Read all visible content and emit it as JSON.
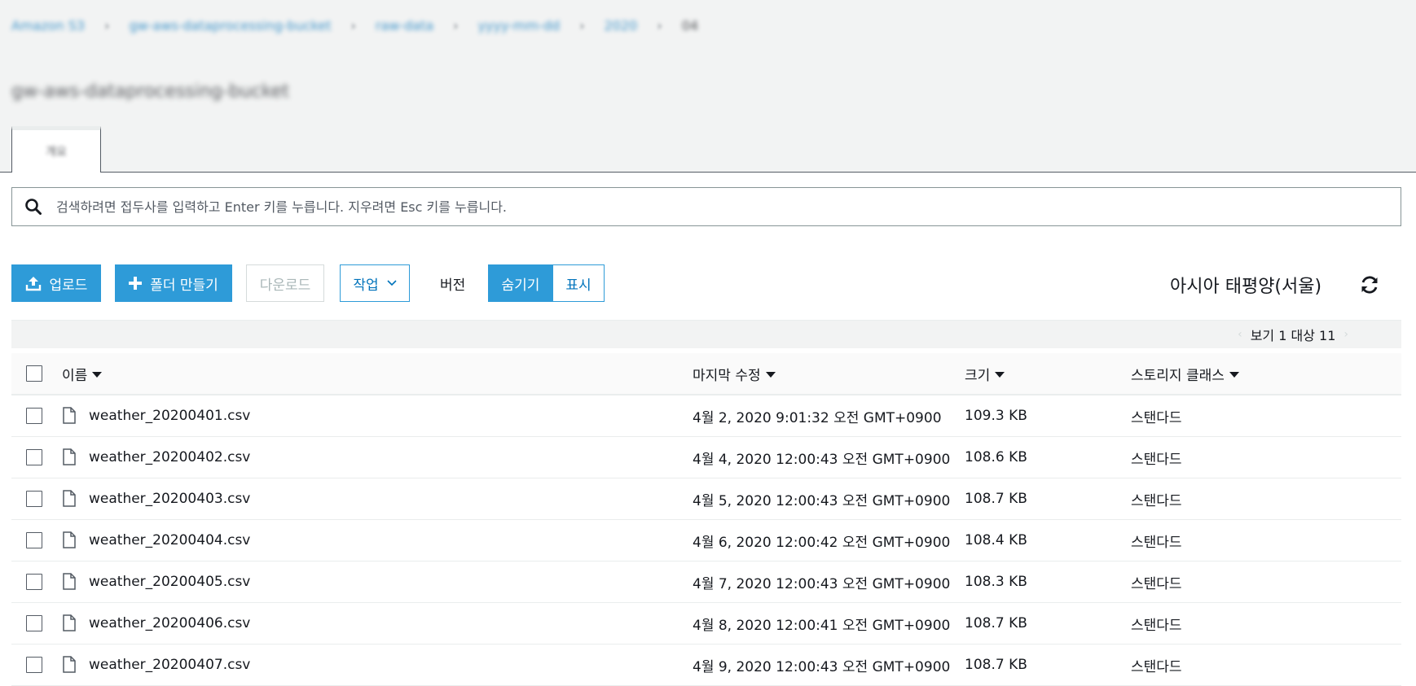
{
  "breadcrumb": [
    "Amazon S3",
    "gw-aws-dataprocessing-bucket",
    "raw-data",
    "yyyy-mm-dd",
    "2020",
    "04"
  ],
  "bucket_name": "gw-aws-dataprocessing-bucket",
  "tab": {
    "label": "개요"
  },
  "search": {
    "placeholder": "검색하려면 접두사를 입력하고 Enter 키를 누릅니다. 지우려면 Esc 키를 누릅니다."
  },
  "toolbar": {
    "upload_label": "업로드",
    "create_folder_label": "폴더 만들기",
    "download_label": "다운로드",
    "actions_label": "작업",
    "versions_label": "버전",
    "hide_label": "숨기기",
    "show_label": "표시",
    "versions_state": "hide"
  },
  "region": "아시아 태평양(서울)",
  "pager": {
    "text": "보기 1 대상 11"
  },
  "table": {
    "columns": {
      "name": "이름",
      "modified": "마지막 수정",
      "size": "크기",
      "storage": "스토리지 클래스"
    },
    "rows": [
      {
        "name": "weather_20200401.csv",
        "modified": "4월 2, 2020 9:01:32 오전 GMT+0900",
        "size": "109.3 KB",
        "storage": "스탠다드"
      },
      {
        "name": "weather_20200402.csv",
        "modified": "4월 4, 2020 12:00:43 오전 GMT+0900",
        "size": "108.6 KB",
        "storage": "스탠다드"
      },
      {
        "name": "weather_20200403.csv",
        "modified": "4월 5, 2020 12:00:43 오전 GMT+0900",
        "size": "108.7 KB",
        "storage": "스탠다드"
      },
      {
        "name": "weather_20200404.csv",
        "modified": "4월 6, 2020 12:00:42 오전 GMT+0900",
        "size": "108.4 KB",
        "storage": "스탠다드"
      },
      {
        "name": "weather_20200405.csv",
        "modified": "4월 7, 2020 12:00:43 오전 GMT+0900",
        "size": "108.3 KB",
        "storage": "스탠다드"
      },
      {
        "name": "weather_20200406.csv",
        "modified": "4월 8, 2020 12:00:41 오전 GMT+0900",
        "size": "108.7 KB",
        "storage": "스탠다드"
      },
      {
        "name": "weather_20200407.csv",
        "modified": "4월 9, 2020 12:00:43 오전 GMT+0900",
        "size": "108.7 KB",
        "storage": "스탠다드"
      }
    ]
  },
  "colors": {
    "primary": "#2e9bd8",
    "link": "#0073bb",
    "header_bg": "#f2f3f3",
    "border": "#eaeded"
  },
  "icons": [
    "search-icon",
    "upload-icon",
    "plus-icon",
    "chevron-down-icon",
    "refresh-icon",
    "file-icon",
    "sort-caret-icon"
  ]
}
